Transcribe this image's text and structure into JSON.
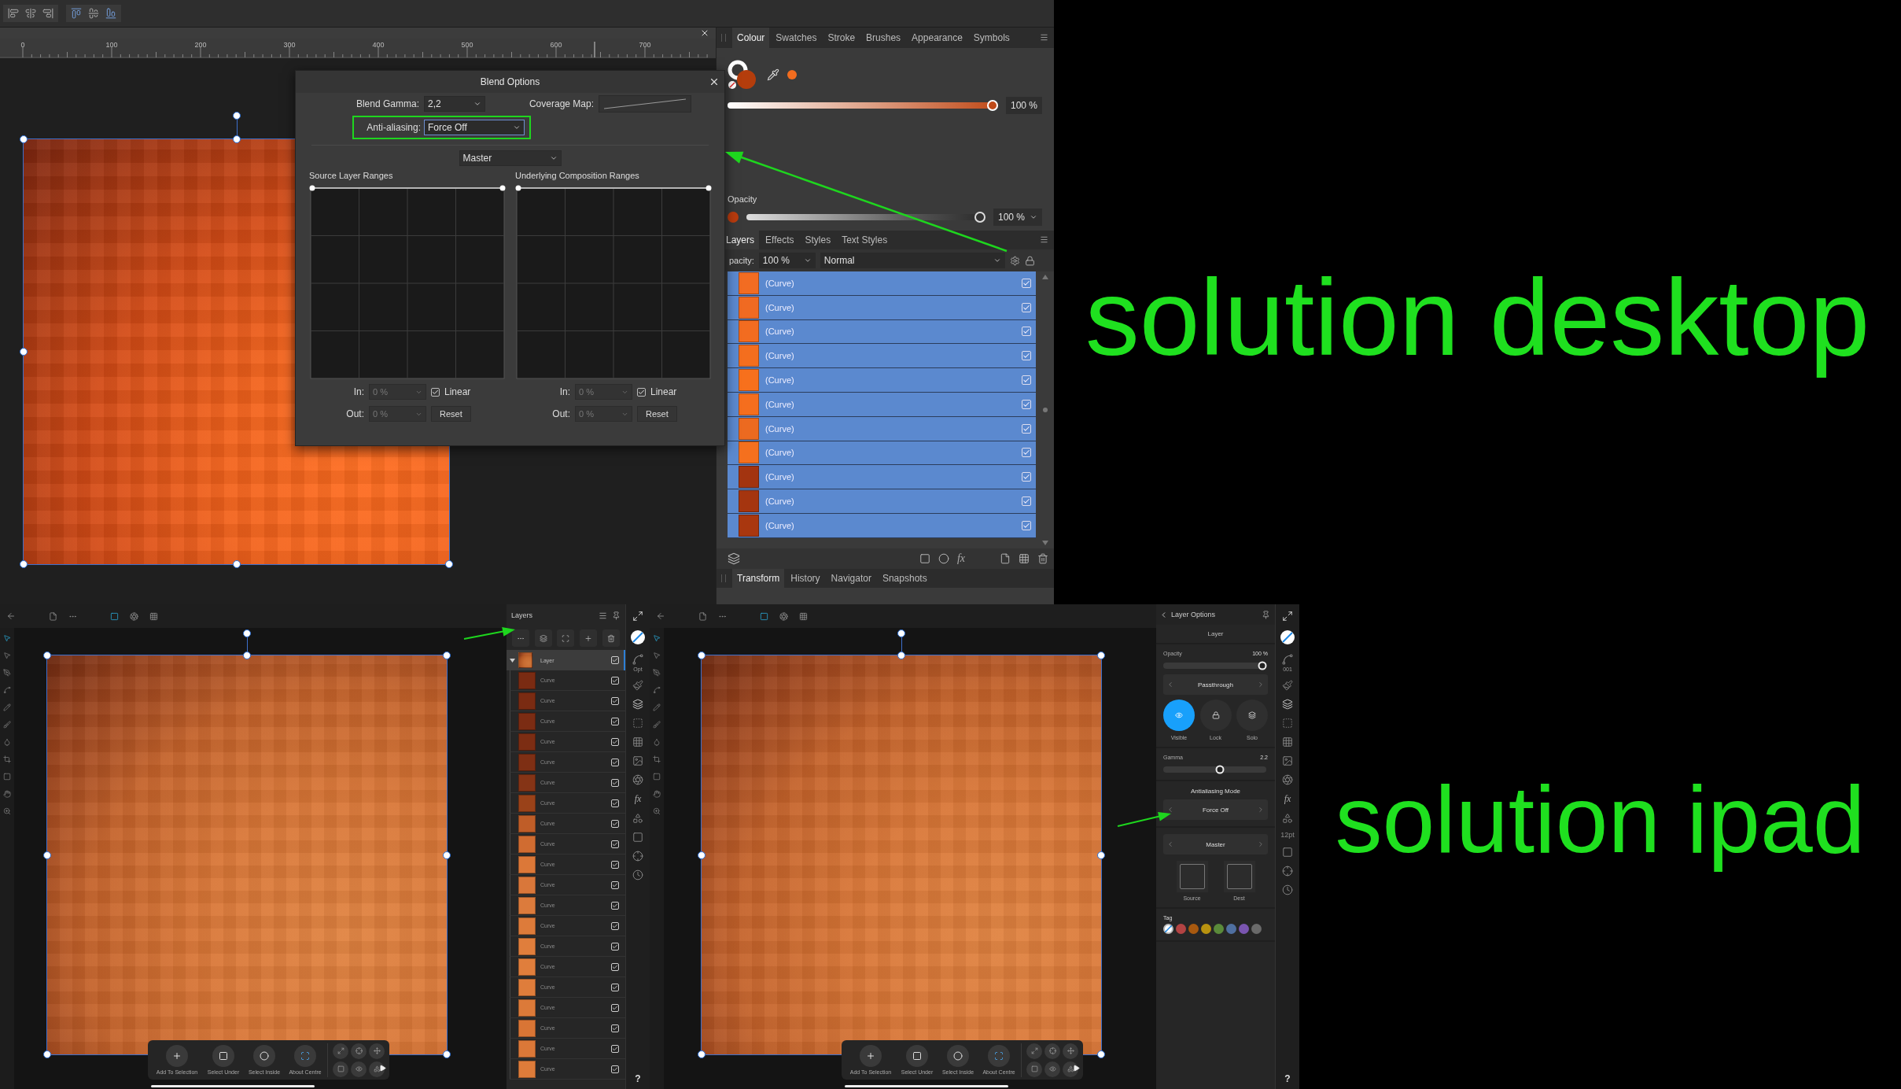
{
  "desktop": {
    "ruler": [
      "0",
      "100",
      "200",
      "300",
      "400",
      "500",
      "600",
      "700"
    ],
    "blend_options": {
      "title": "Blend Options",
      "blend_gamma_label": "Blend Gamma:",
      "blend_gamma": "2,2",
      "coverage_map_label": "Coverage Map:",
      "anti_aliasing_label": "Anti-aliasing:",
      "anti_aliasing": "Force Off",
      "channel": "Master",
      "ranges": [
        {
          "title": "Source Layer Ranges",
          "in_label": "In:",
          "in_value": "0 %",
          "linear_label": "Linear",
          "linear_checked": true,
          "out_label": "Out:",
          "out_value": "0 %",
          "reset": "Reset"
        },
        {
          "title": "Underlying Composition Ranges",
          "in_label": "In:",
          "in_value": "0 %",
          "linear_label": "Linear",
          "linear_checked": true,
          "out_label": "Out:",
          "out_value": "0 %",
          "reset": "Reset"
        }
      ]
    },
    "colour_panel": {
      "tabs": [
        {
          "label": "Colour",
          "selected": true
        },
        {
          "label": "Swatches",
          "selected": false
        },
        {
          "label": "Stroke",
          "selected": false
        },
        {
          "label": "Brushes",
          "selected": false
        },
        {
          "label": "Appearance",
          "selected": false
        },
        {
          "label": "Symbols",
          "selected": false
        }
      ],
      "tint": {
        "level": 1,
        "reading": "100 %"
      },
      "opacity_label": "Opacity",
      "opacity": {
        "level": 1,
        "reading": "100 %"
      }
    },
    "layers_panel": {
      "tabs": [
        {
          "label": "Layers",
          "selected": true
        },
        {
          "label": "Effects",
          "selected": false
        },
        {
          "label": "Styles",
          "selected": false
        },
        {
          "label": "Text Styles",
          "selected": false
        }
      ],
      "opacity_label": "pacity:",
      "opacity_value": "100 %",
      "blend_mode": "Normal",
      "fx": "fx",
      "rows": [
        {
          "name": "(Curve)",
          "color": "#f26c22",
          "checked": true,
          "selected": true
        },
        {
          "name": "(Curve)",
          "color": "#f06a22",
          "checked": true,
          "selected": true
        },
        {
          "name": "(Curve)",
          "color": "#f26c20",
          "checked": true,
          "selected": true
        },
        {
          "name": "(Curve)",
          "color": "#f46e1e",
          "checked": true,
          "selected": true
        },
        {
          "name": "(Curve)",
          "color": "#f7701c",
          "checked": true,
          "selected": true
        },
        {
          "name": "(Curve)",
          "color": "#f56e1e",
          "checked": true,
          "selected": true
        },
        {
          "name": "(Curve)",
          "color": "#ec6a20",
          "checked": true,
          "selected": true
        },
        {
          "name": "(Curve)",
          "color": "#f5701e",
          "checked": true,
          "selected": true
        },
        {
          "name": "(Curve)",
          "color": "#a33410",
          "checked": true,
          "selected": true
        },
        {
          "name": "(Curve)",
          "color": "#a5350f",
          "checked": true,
          "selected": true
        },
        {
          "name": "(Curve)",
          "color": "#a9370f",
          "checked": true,
          "selected": true
        }
      ]
    },
    "bottom_tabs": [
      {
        "label": "Transform",
        "selected": true
      },
      {
        "label": "History",
        "selected": false
      },
      {
        "label": "Navigator",
        "selected": false
      },
      {
        "label": "Snapshots",
        "selected": false
      }
    ]
  },
  "desktop_caption": "solution desktop",
  "ipad_screens": [
    {
      "kind": "layers",
      "strip": {
        "brush_caption": "Opt",
        "fx": "fx",
        "help": "?"
      },
      "layers": {
        "title": "Layers",
        "root": {
          "name": "Layer",
          "expanded": true,
          "checked": true,
          "selected": true,
          "children": [
            {
              "name": "Curve",
              "color": "#7a2b12",
              "checked": true,
              "selected": false
            },
            {
              "name": "Curve",
              "color": "#7a2b12",
              "checked": true,
              "selected": false
            },
            {
              "name": "Curve",
              "color": "#7b2c13",
              "checked": true,
              "selected": false
            },
            {
              "name": "Curve",
              "color": "#7c2d13",
              "checked": true,
              "selected": false
            },
            {
              "name": "Curve",
              "color": "#7e2f14",
              "checked": true,
              "selected": false
            },
            {
              "name": "Curve",
              "color": "#853416",
              "checked": true,
              "selected": false
            },
            {
              "name": "Curve",
              "color": "#9a4219",
              "checked": true,
              "selected": false
            },
            {
              "name": "Curve",
              "color": "#bf5d28",
              "checked": true,
              "selected": false
            },
            {
              "name": "Curve",
              "color": "#d06c31",
              "checked": true,
              "selected": false
            },
            {
              "name": "Curve",
              "color": "#dc7838",
              "checked": true,
              "selected": false
            },
            {
              "name": "Curve",
              "color": "#d9773a",
              "checked": true,
              "selected": false
            },
            {
              "name": "Curve",
              "color": "#dc7b3c",
              "checked": true,
              "selected": false
            },
            {
              "name": "Curve",
              "color": "#dd7b3a",
              "checked": true,
              "selected": false
            },
            {
              "name": "Curve",
              "color": "#e07e3c",
              "checked": true,
              "selected": false
            },
            {
              "name": "Curve",
              "color": "#e07e3c",
              "checked": true,
              "selected": false
            },
            {
              "name": "Curve",
              "color": "#df7d3b",
              "checked": true,
              "selected": false
            },
            {
              "name": "Curve",
              "color": "#dc7a39",
              "checked": true,
              "selected": false
            },
            {
              "name": "Curve",
              "color": "#d97535",
              "checked": true,
              "selected": false
            },
            {
              "name": "Curve",
              "color": "#db7838",
              "checked": true,
              "selected": false
            },
            {
              "name": "Curve",
              "color": "#de7c3a",
              "checked": true,
              "selected": false
            }
          ]
        }
      },
      "context_toolbar": [
        "Add To Selection",
        "Select Under",
        "Select Inside",
        "About Centre"
      ]
    },
    {
      "kind": "options",
      "strip": {
        "brush_caption": "001",
        "text_caption": "12pt",
        "fx": "fx",
        "help": "?"
      },
      "layer_options": {
        "title": "Layer Options",
        "header": "Layer",
        "opacity_label": "Opacity",
        "opacity": {
          "level": 1,
          "reading": "100 %"
        },
        "blend_mode": "Passthrough",
        "toggles": [
          {
            "label": "Visible",
            "on": true
          },
          {
            "label": "Lock",
            "on": false
          },
          {
            "label": "Solo",
            "on": false
          }
        ],
        "gamma_label": "Gamma",
        "gamma": {
          "level": 0.55,
          "reading": "2.2"
        },
        "antialiasing_label": "Antialiasing Mode",
        "antialiasing": "Force Off",
        "channel": "Master",
        "ranges": [
          "Source",
          "Dest"
        ],
        "tag_label": "Tag",
        "tags": [
          {
            "kind": "none",
            "selected": true
          },
          {
            "kind": "color",
            "color": "#b34343",
            "selected": false
          },
          {
            "kind": "color",
            "color": "#a8590f",
            "selected": false
          },
          {
            "kind": "color",
            "color": "#b8920f",
            "selected": false
          },
          {
            "kind": "color",
            "color": "#5a8a3a",
            "selected": false
          },
          {
            "kind": "color",
            "color": "#4f6fa0",
            "selected": false
          },
          {
            "kind": "color",
            "color": "#7a55b0",
            "selected": false
          },
          {
            "kind": "color",
            "color": "#6a6a6a",
            "selected": false
          }
        ]
      },
      "context_toolbar": [
        "Add To Selection",
        "Select Under",
        "Select Inside",
        "About Centre"
      ]
    }
  ],
  "ipad_caption": "solution ipad"
}
